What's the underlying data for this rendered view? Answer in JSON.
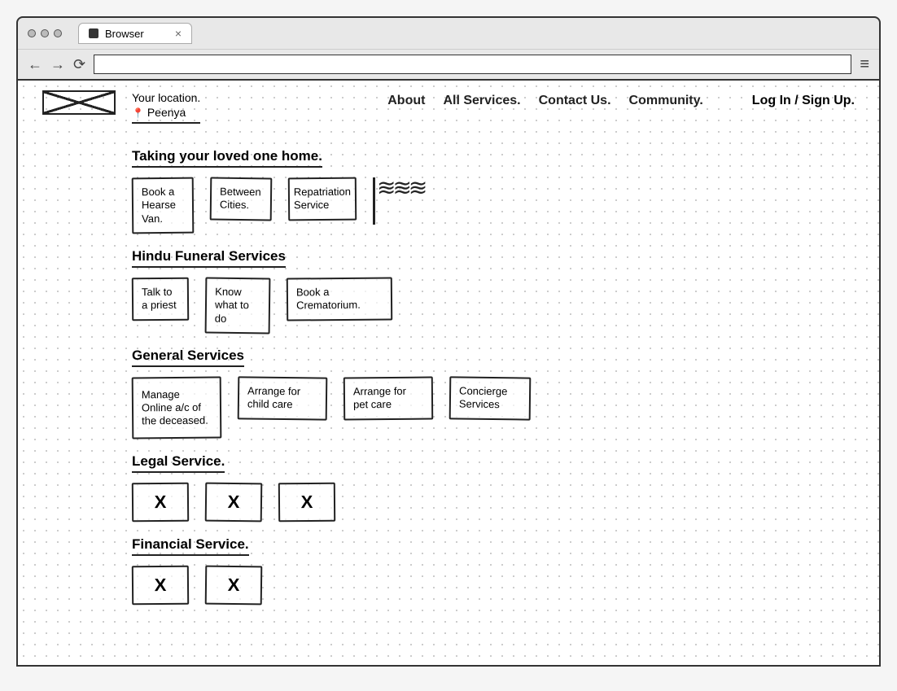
{
  "browser": {
    "tab_title": "Browser",
    "close_glyph": "×"
  },
  "header": {
    "location_label": "Your location.",
    "location_value": "Peenya",
    "nav": [
      "About",
      "All Services.",
      "Contact Us.",
      "Community."
    ],
    "auth": "Log In / Sign Up."
  },
  "sections": [
    {
      "title": "Taking your loved one home.",
      "cards": [
        "Book a Hearse Van.",
        "Between Cities.",
        "Repatriation Service"
      ],
      "has_sketch": true
    },
    {
      "title": "Hindu Funeral Services",
      "cards": [
        "Talk to a priest",
        "Know what to do",
        "Book a Crematorium."
      ]
    },
    {
      "title": "General Services",
      "cards": [
        "Manage Online a/c of the deceased.",
        "Arrange for child care",
        "Arrange for pet care",
        "Concierge Services"
      ]
    },
    {
      "title": "Legal Service.",
      "placeholders": 3
    },
    {
      "title": "Financial Service.",
      "placeholders": 2
    }
  ]
}
